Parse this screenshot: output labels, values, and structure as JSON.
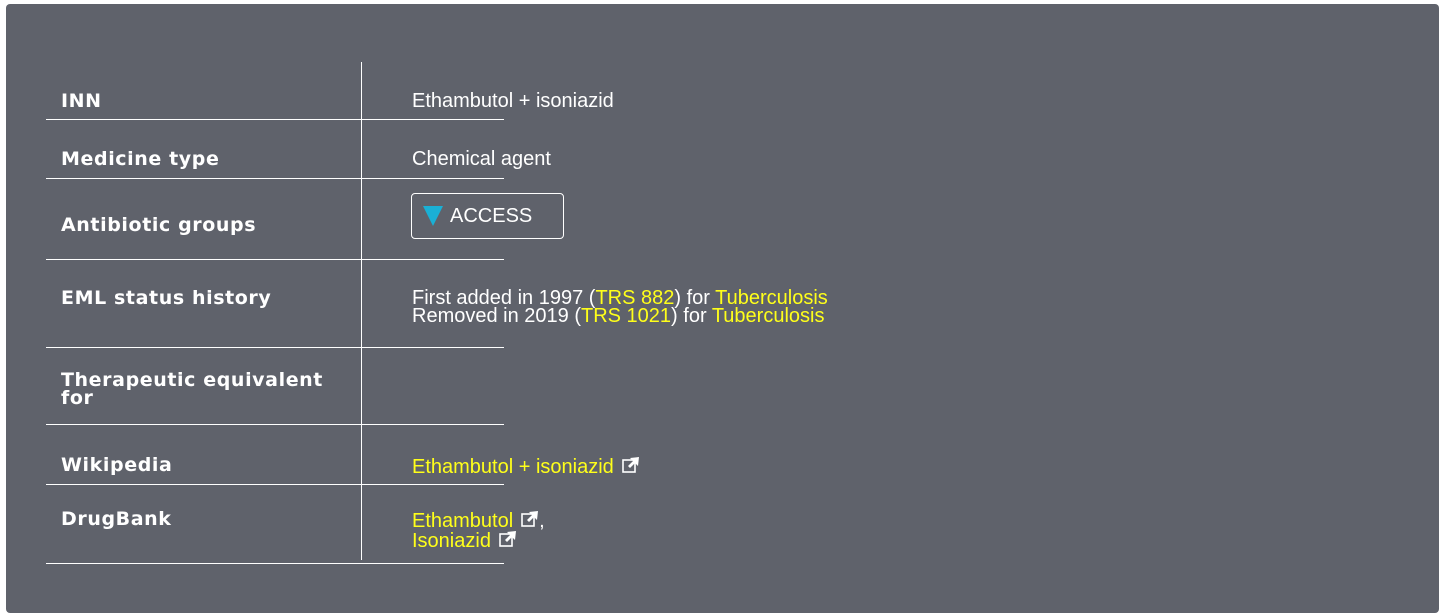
{
  "colors": {
    "panel_bg": "#5f626b",
    "text": "#ffffff",
    "link": "#ffff1a",
    "access_badge": "#1ab0d5"
  },
  "rows": {
    "inn": {
      "label": "INN",
      "value": "Ethambutol + isoniazid"
    },
    "medicine_type": {
      "label": "Medicine type",
      "value": "Chemical agent"
    },
    "antibiotic_groups": {
      "label": "Antibiotic groups",
      "badge_icon": "triangle-down-icon",
      "badge_label": "ACCESS"
    },
    "eml_status": {
      "label": "EML status history",
      "line1": {
        "prefix": "First added in 1997 (",
        "trs": "TRS 882",
        "mid": ") for ",
        "indication": "Tuberculosis"
      },
      "line2": {
        "prefix": "Removed in 2019 (",
        "trs": "TRS 1021",
        "mid": ") for ",
        "indication": "Tuberculosis"
      }
    },
    "therapeutic_equivalent": {
      "label_line1": "Therapeutic equivalent",
      "label_line2": "for",
      "value": ""
    },
    "wikipedia": {
      "label": "Wikipedia",
      "link": "Ethambutol + isoniazid",
      "icon": "external-link-icon"
    },
    "drugbank": {
      "label": "DrugBank",
      "link1": "Ethambutol",
      "separator": ",",
      "link2": "Isoniazid",
      "icon": "external-link-icon"
    }
  }
}
